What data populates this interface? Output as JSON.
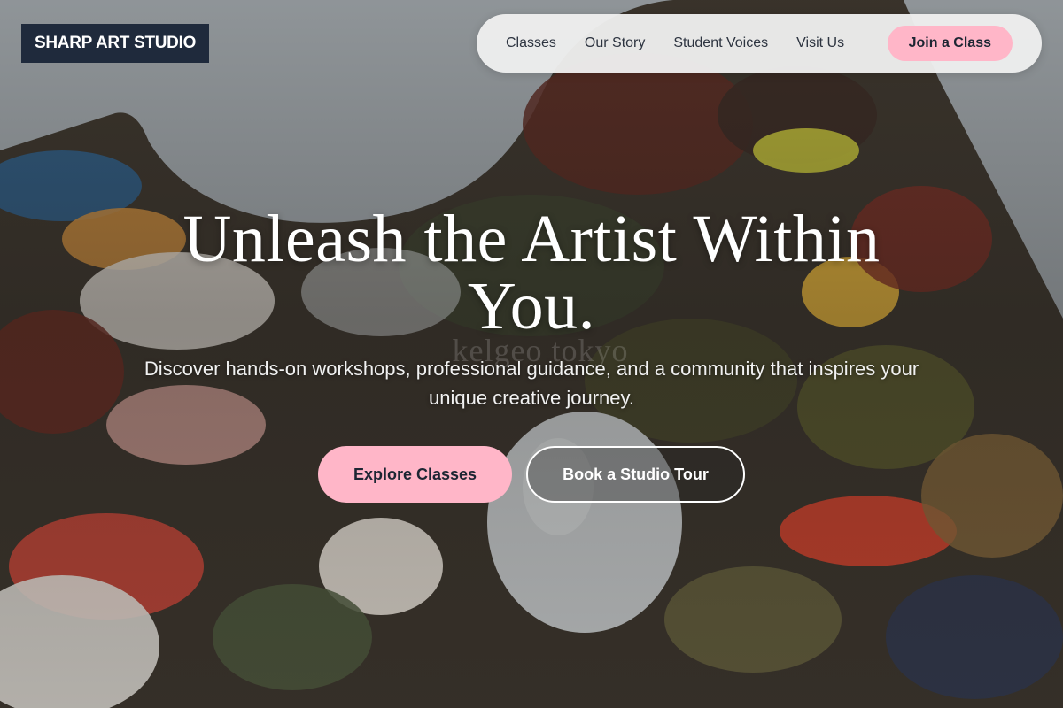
{
  "brand": {
    "logo_text": "SHARP ART STUDIO"
  },
  "nav": {
    "links": [
      "Classes",
      "Our Story",
      "Student Voices",
      "Visit Us"
    ],
    "cta_label": "Join a Class"
  },
  "hero": {
    "title": "Unleash the Artist Within You.",
    "subtitle": "Discover hands-on workshops, professional guidance, and a community that inspires your unique creative journey.",
    "primary_button": "Explore Classes",
    "secondary_button": "Book a Studio Tour",
    "watermark": "kelgeo tokyo"
  },
  "colors": {
    "logo_bg": "#1f2a3c",
    "accent_pink": "#ffb6c8",
    "nav_bg": "#eeeeee",
    "text_dark": "#1d2633"
  }
}
